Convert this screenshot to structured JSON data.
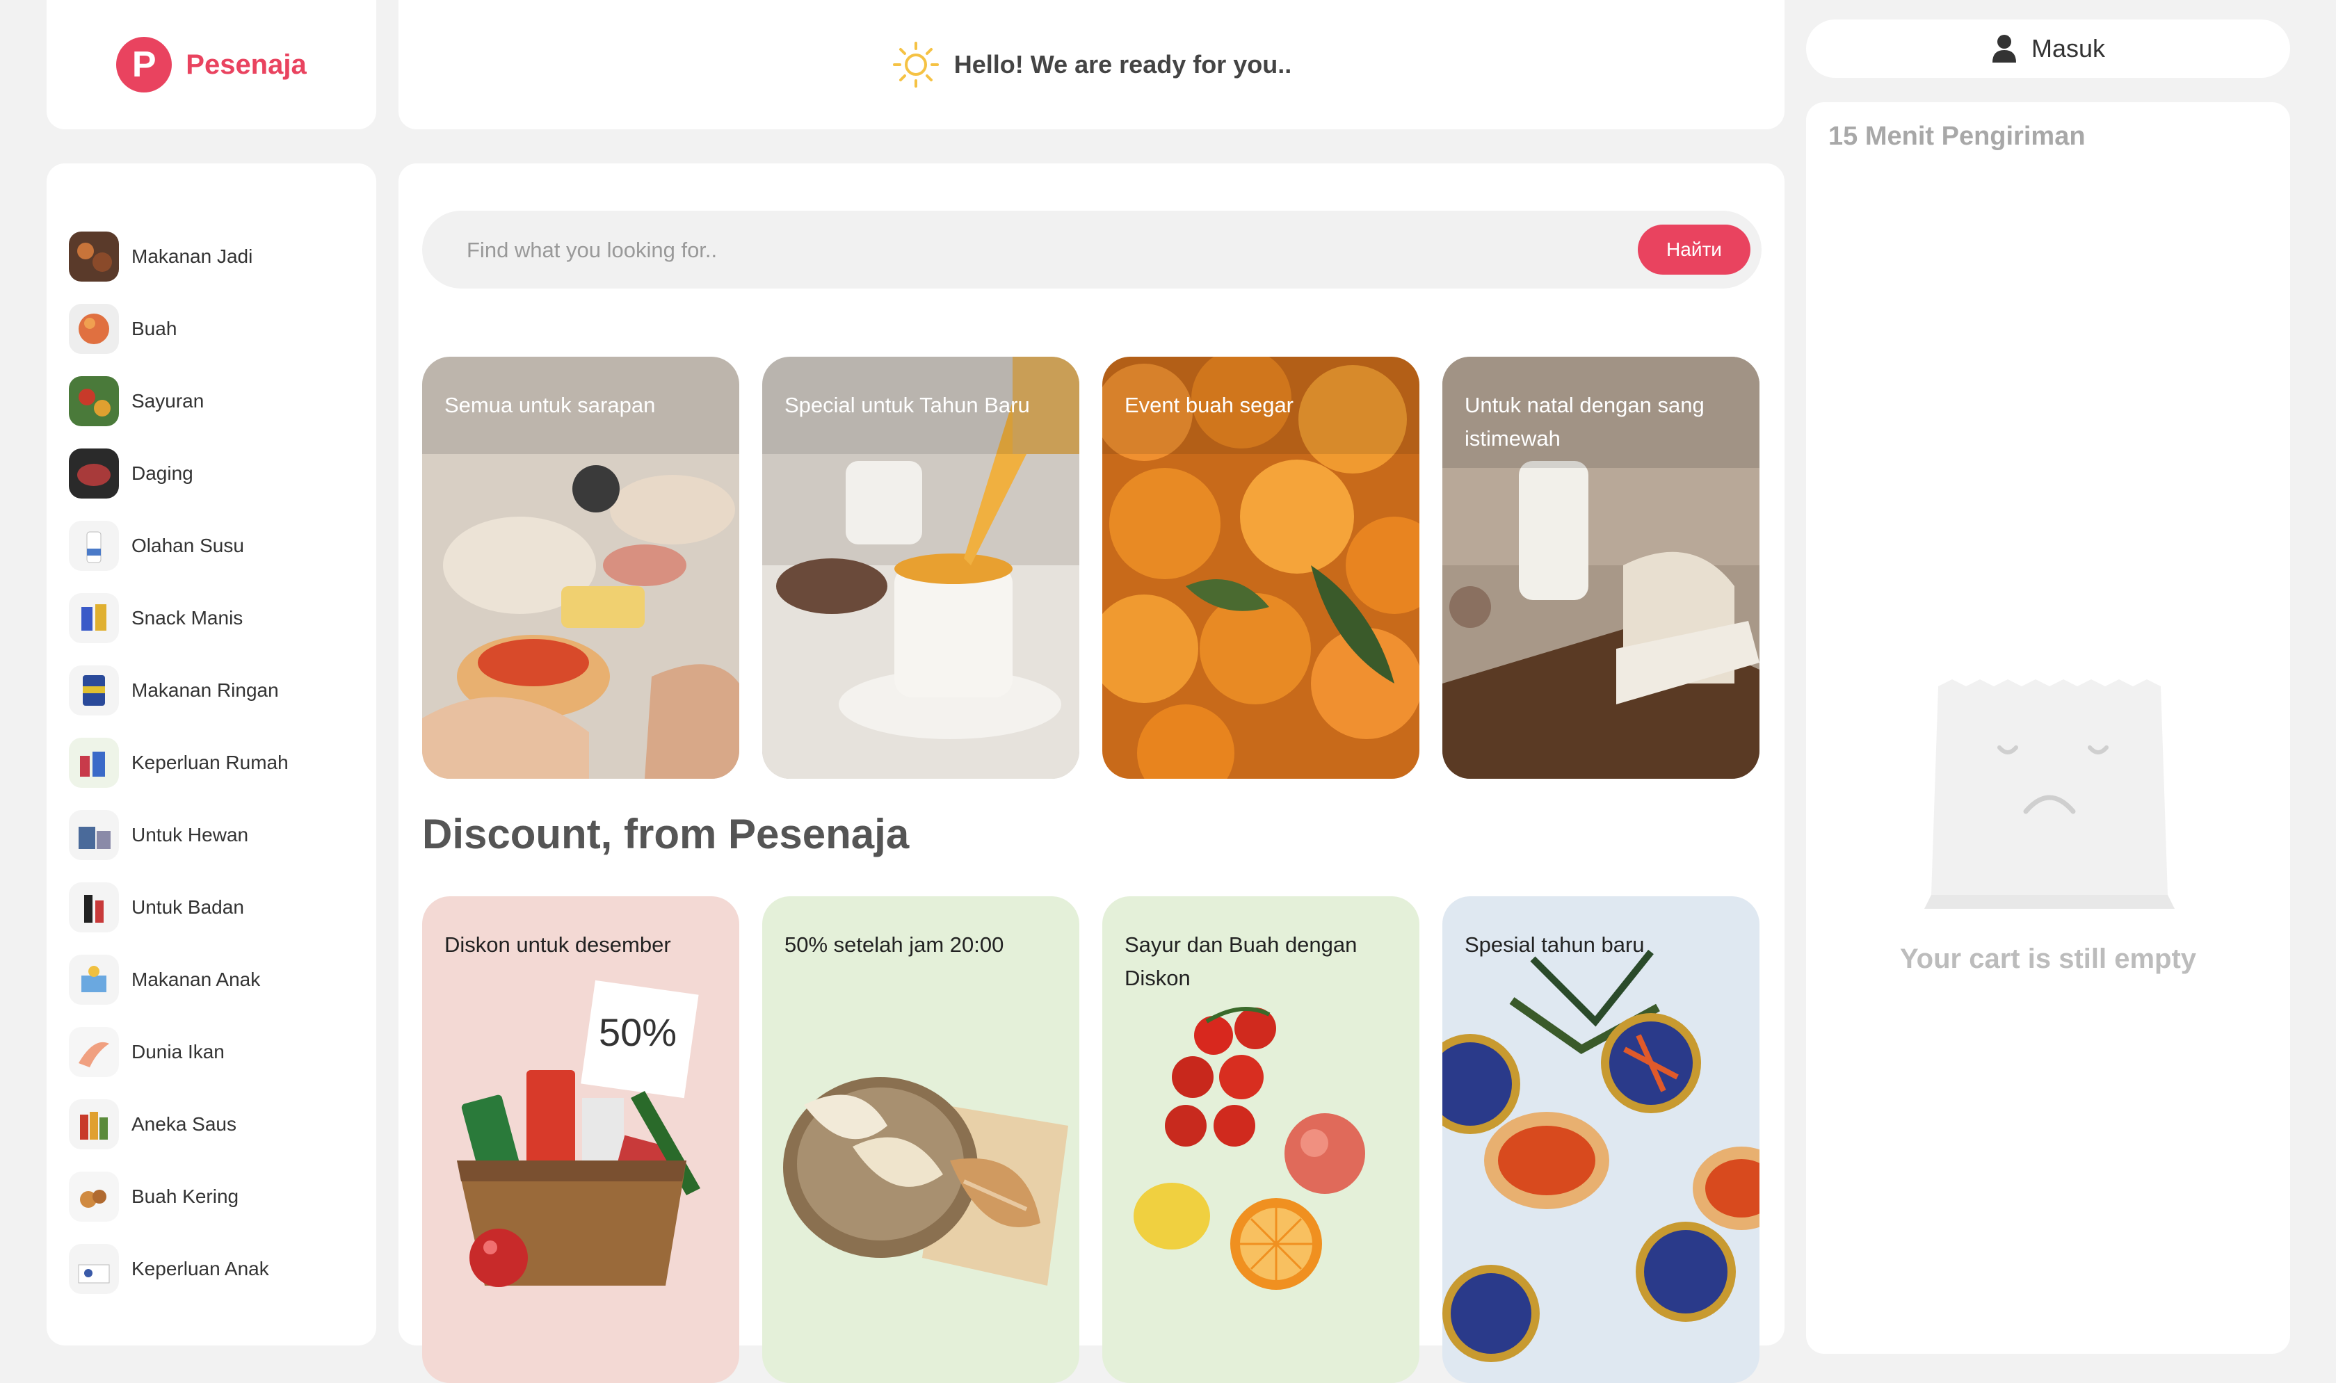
{
  "brand": {
    "logo_letter": "P",
    "name": "Pesenaja",
    "color": "#e9435f"
  },
  "header": {
    "greeting": "Hello! We are ready for you.."
  },
  "login": {
    "label": "Masuk"
  },
  "sidebar": {
    "items": [
      {
        "label": "Makanan Jadi"
      },
      {
        "label": "Buah"
      },
      {
        "label": "Sayuran"
      },
      {
        "label": "Daging"
      },
      {
        "label": "Olahan Susu"
      },
      {
        "label": "Snack Manis"
      },
      {
        "label": "Makanan Ringan"
      },
      {
        "label": "Keperluan Rumah"
      },
      {
        "label": "Untuk Hewan"
      },
      {
        "label": "Untuk Badan"
      },
      {
        "label": "Makanan Anak"
      },
      {
        "label": "Dunia Ikan"
      },
      {
        "label": "Aneka Saus"
      },
      {
        "label": "Buah Kering"
      },
      {
        "label": "Keperluan Anak"
      }
    ]
  },
  "search": {
    "placeholder": "Find what you looking for..",
    "button": "Найти"
  },
  "promos": [
    {
      "label": "Semua untuk sarapan"
    },
    {
      "label": "Special untuk Tahun Baru"
    },
    {
      "label": "Event buah segar"
    },
    {
      "label": "Untuk natal dengan sang istimewah"
    }
  ],
  "discount": {
    "title": "Discount, from Pesenaja",
    "cards": [
      {
        "label": "Diskon untuk desember",
        "badge": "50%",
        "bg": "#f3d9d4"
      },
      {
        "label": "50% setelah jam 20:00",
        "bg": "#e4f0d9"
      },
      {
        "label": "Sayur dan Buah dengan Diskon",
        "bg": "#e4f0d9"
      },
      {
        "label": "Spesial tahun baru",
        "bg": "#dfe8f1"
      }
    ]
  },
  "cart": {
    "title": "15 Menit Pengiriman",
    "empty_text": "Your cart is still empty"
  }
}
